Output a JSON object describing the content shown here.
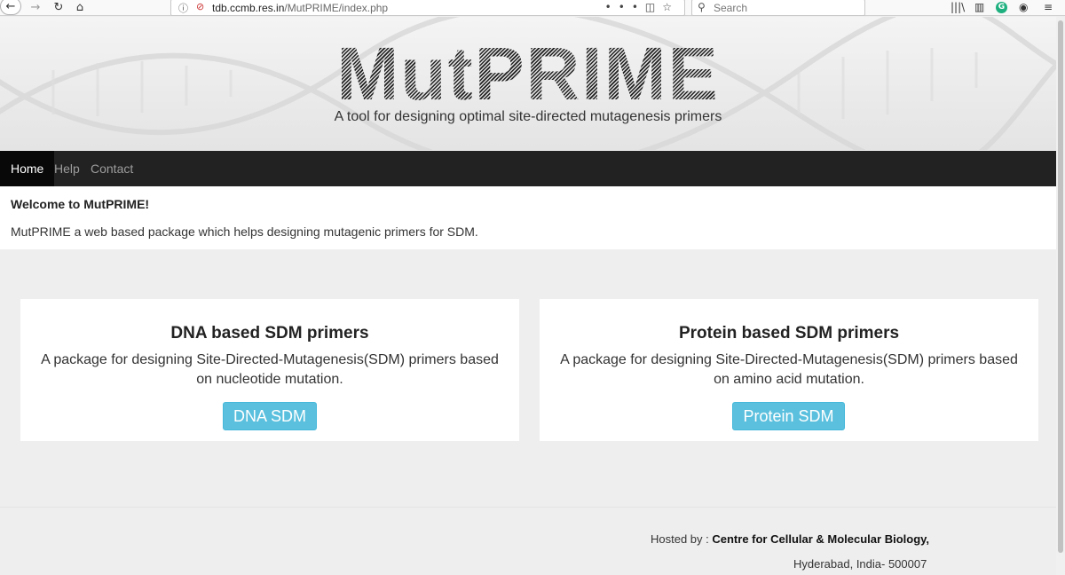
{
  "browser": {
    "url_domain": "tdb.ccmb.res.in",
    "url_path": "/MutPRIME/index.php",
    "search_placeholder": "Search"
  },
  "header": {
    "logo_text": "MutPRIME",
    "tagline": "A tool for designing optimal site-directed mutagenesis primers"
  },
  "nav": {
    "items": [
      {
        "label": "Home",
        "active": true
      },
      {
        "label": "Help",
        "active": false
      },
      {
        "label": "Contact",
        "active": false
      }
    ]
  },
  "welcome": {
    "title": "Welcome to MutPRIME!",
    "text": "MutPRIME a web based package which helps designing mutagenic primers for SDM."
  },
  "cards": [
    {
      "title": "DNA based SDM primers",
      "description": "A package for designing Site-Directed-Mutagenesis(SDM) primers based on nucleotide mutation.",
      "button": "DNA SDM"
    },
    {
      "title": "Protein based SDM primers",
      "description": "A package for designing Site-Directed-Mutagenesis(SDM) primers based on amino acid mutation.",
      "button": "Protein SDM"
    }
  ],
  "footer": {
    "hosted_label": "Hosted by : ",
    "host_name": "Centre for Cellular & Molecular Biology,",
    "address": "Hyderabad, India- 500007"
  },
  "colors": {
    "navbar": "#222222",
    "button": "#5bc0de",
    "page_bg": "#eeeeee"
  }
}
